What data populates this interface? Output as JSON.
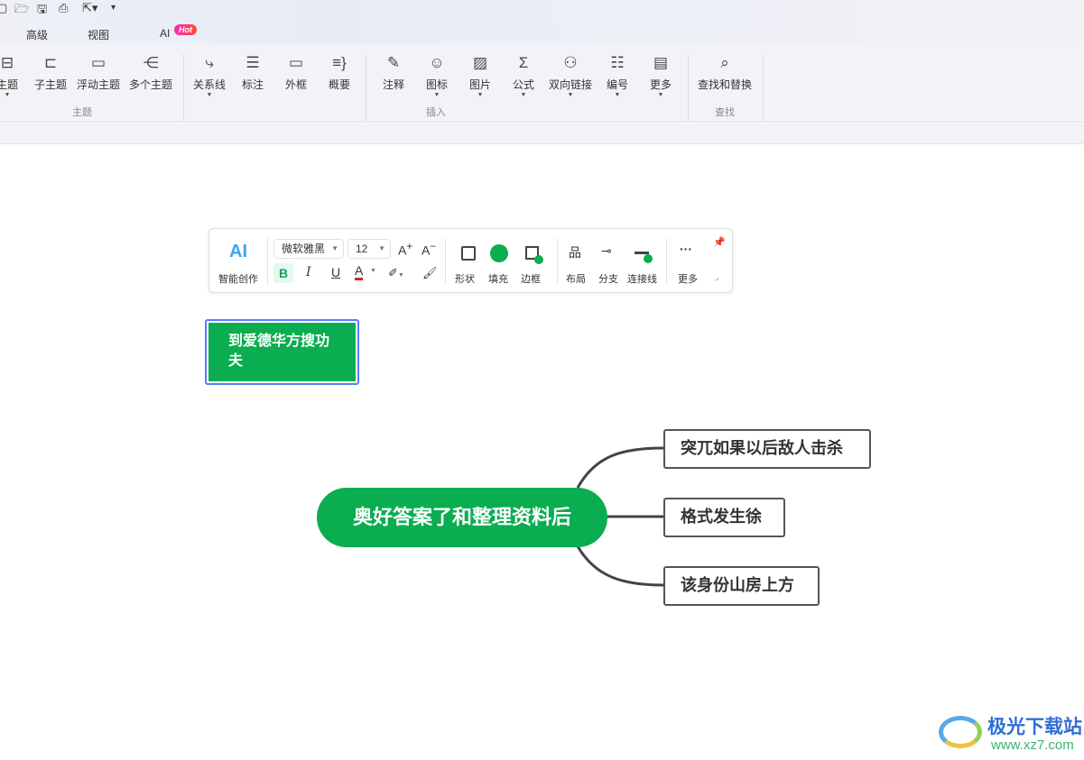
{
  "quick_access": {
    "icons": [
      "new-icon",
      "open-folder-icon",
      "save-icon",
      "print-icon",
      "export-icon",
      "customize-icon"
    ]
  },
  "menu": {
    "items": [
      "高级",
      "视图",
      "AI"
    ],
    "hot_badge": "Hot"
  },
  "ribbon": {
    "buttons": [
      {
        "label": "主题",
        "icon": "topic-icon",
        "dropdown": true
      },
      {
        "label": "子主题",
        "icon": "subtopic-icon"
      },
      {
        "label": "浮动主题",
        "icon": "floating-topic-icon"
      },
      {
        "label": "多个主题",
        "icon": "multiple-topics-icon"
      },
      {
        "label": "关系线",
        "icon": "relation-line-icon",
        "dropdown": true
      },
      {
        "label": "标注",
        "icon": "callout-icon"
      },
      {
        "label": "外框",
        "icon": "boundary-icon"
      },
      {
        "label": "概要",
        "icon": "summary-icon"
      },
      {
        "label": "注释",
        "icon": "note-icon"
      },
      {
        "label": "图标",
        "icon": "emoji-icon",
        "dropdown": true
      },
      {
        "label": "图片",
        "icon": "image-icon",
        "dropdown": true
      },
      {
        "label": "公式",
        "icon": "formula-icon",
        "dropdown": true
      },
      {
        "label": "双向链接",
        "icon": "bidirectional-link-icon",
        "dropdown": true
      },
      {
        "label": "编号",
        "icon": "numbering-icon",
        "dropdown": true
      },
      {
        "label": "更多",
        "icon": "more-icon",
        "dropdown": true
      },
      {
        "label": "查找和替换",
        "icon": "find-replace-icon"
      }
    ],
    "groups": [
      "主题",
      "插入",
      "查找"
    ]
  },
  "floating_toolbar": {
    "ai_label": "AI",
    "ai_caption": "智能创作",
    "font": "微软雅黑",
    "size": "12",
    "grow": "A",
    "shrink": "A",
    "bold": "B",
    "italic": "I",
    "underline": "U",
    "font_color": "A",
    "font_color_value": "#e02020",
    "shape": "形状",
    "fill": "填充",
    "border": "边框",
    "layout": "布局",
    "branch": "分支",
    "connector": "连接线",
    "more": "更多",
    "fill_color": "#0aad50"
  },
  "mindmap": {
    "floating_topic": "到爱德华方搜功夫",
    "central": "奥好答案了和整理资料后",
    "branches": [
      "突兀如果以后敌人击杀",
      "格式发生徐",
      "该身份山房上方"
    ],
    "node_color": "#0aad50",
    "selection_color": "#5b7bff"
  },
  "watermark": {
    "name": "极光下载站",
    "url": "www.xz7.com"
  }
}
